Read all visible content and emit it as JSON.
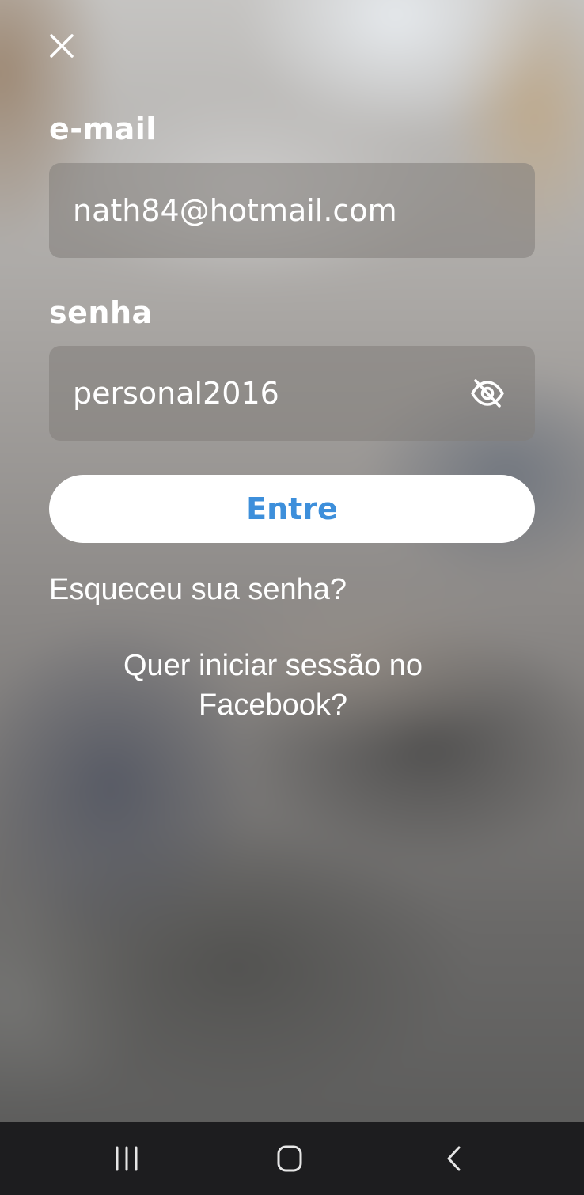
{
  "form": {
    "email_label": "e-mail",
    "email_value": "nath84@hotmail.com",
    "password_label": "senha",
    "password_value": "personal2016",
    "login_button_label": "Entre",
    "forgot_password_link": "Esqueceu sua senha?",
    "facebook_login_line1": "Quer iniciar sessão no",
    "facebook_login_line2": "Facebook?"
  },
  "icons": {
    "close": "close-icon",
    "toggle_password": "eye-slash-icon",
    "nav_recents": "recents-icon",
    "nav_home": "home-icon",
    "nav_back": "back-icon"
  },
  "colors": {
    "accent": "#3d8fdb",
    "text": "#ffffff",
    "navbar": "#1d1d1f"
  }
}
